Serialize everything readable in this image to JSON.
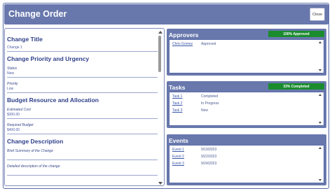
{
  "header": {
    "title": "Change Order",
    "close_label": "Close"
  },
  "left": {
    "sections": {
      "change_title": {
        "heading": "Change Title",
        "value": "Change 1"
      },
      "priority": {
        "heading": "Change Priority and Urgency",
        "status_label": "Status",
        "status_value": "New",
        "priority_label": "Priority",
        "priority_value": "Low"
      },
      "budget": {
        "heading": "Budget Resource and Allocation",
        "estimated_label": "Estimated Cost",
        "estimated_value": "$300.00",
        "required_label": "Required Budget",
        "required_value": "$400.00"
      },
      "description": {
        "heading": "Change Description",
        "brief_label": "Brief Summary of the Change",
        "detailed_label": "Detailed description of the change"
      }
    }
  },
  "approvers": {
    "title": "Approvers",
    "badge": "100% Approved",
    "badge_color": "#1a8c2e",
    "rows": [
      {
        "name": "Chris Gomez",
        "status": "Approved"
      }
    ]
  },
  "tasks": {
    "title": "Tasks",
    "badge": "33% Completed",
    "badge_color": "#1a8c2e",
    "rows": [
      {
        "name": "Task 1",
        "status": "Completed"
      },
      {
        "name": "Task 2",
        "status": "In Progress"
      },
      {
        "name": "Task 3",
        "status": "New"
      }
    ]
  },
  "events": {
    "title": "Events",
    "rows": [
      {
        "name": "Event 1",
        "date": "9/19/2023"
      },
      {
        "name": "Event 2",
        "date": "9/22/2023"
      },
      {
        "name": "Event 3",
        "date": "9/24/2023"
      }
    ]
  }
}
